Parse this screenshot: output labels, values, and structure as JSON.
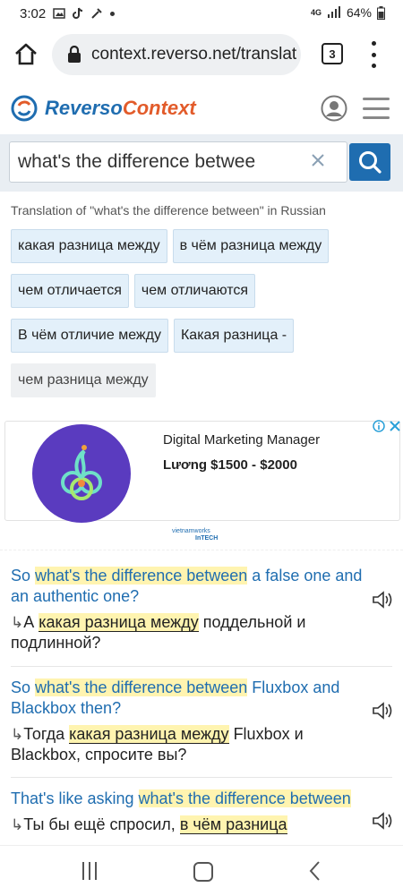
{
  "status": {
    "time": "3:02",
    "battery": "64%",
    "net": "4G"
  },
  "browser": {
    "url": "context.reverso.net/translat",
    "tab_count": "3"
  },
  "site": {
    "logo_part1": "Reverso",
    "logo_part2": "Context"
  },
  "search": {
    "query": "what's the difference betwee"
  },
  "translation_title": "Translation of \"what's the difference between\" in Russian",
  "chips": [
    [
      "какая разница между",
      "в чём разница между"
    ],
    [
      "чем отличается",
      "чем отличаются"
    ],
    [
      "В чём отличие между",
      "Какая разница -"
    ]
  ],
  "chip_plain": "чем разница между",
  "ad": {
    "title": "Digital Marketing Manager",
    "salary": "Lương $1500 - $2000",
    "brand_top": "vietnamworks",
    "brand_bottom": "InTECH"
  },
  "examples": [
    {
      "src_pre": "So ",
      "src_hl": "what's the difference between",
      "src_post": " a false one and an authentic one?",
      "tgt_pre": "А ",
      "tgt_hl": "какая разница между",
      "tgt_post": " поддельной и подлинной?"
    },
    {
      "src_pre": "So ",
      "src_hl": "what's the difference between",
      "src_post": " Fluxbox and Blackbox then?",
      "tgt_pre": "Тогда ",
      "tgt_hl": "какая разница между",
      "tgt_post": " Fluxbox и Blackbox, спросите вы?"
    },
    {
      "src_pre": "That's like asking ",
      "src_hl": "what's the difference between",
      "src_post": "",
      "tgt_pre": "Ты бы ещё спросил, ",
      "tgt_hl": "в чём разница",
      "tgt_post": ""
    }
  ],
  "colors": {
    "brand_blue": "#1f6db0",
    "brand_orange": "#e25b2a",
    "highlight": "#fff4b0"
  }
}
